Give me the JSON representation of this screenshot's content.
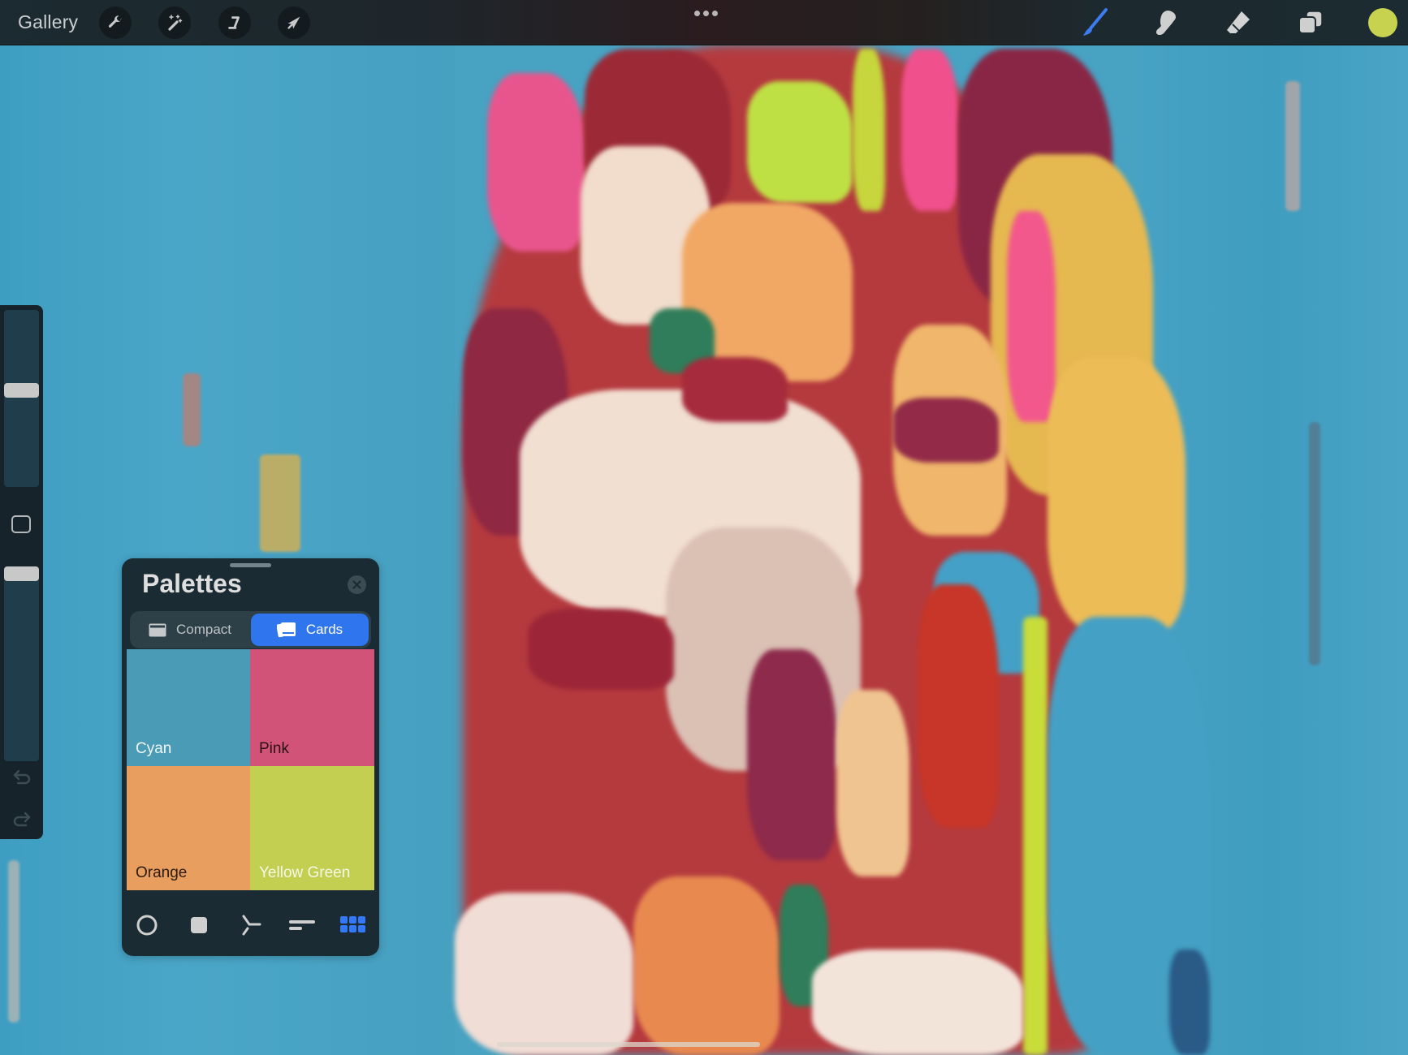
{
  "app": {
    "gallery_label": "Gallery",
    "more_menu_icon": "more-horizontal-icon"
  },
  "toolbar_left": [
    {
      "name": "actions",
      "icon": "wrench-icon"
    },
    {
      "name": "adjustments",
      "icon": "magic-wand-icon"
    },
    {
      "name": "selection",
      "icon": "selection-s-icon"
    },
    {
      "name": "transform",
      "icon": "arrow-cursor-icon"
    }
  ],
  "toolbar_right": [
    {
      "name": "brush",
      "icon": "brush-icon",
      "active": true
    },
    {
      "name": "smudge",
      "icon": "smudge-finger-icon",
      "active": false
    },
    {
      "name": "eraser",
      "icon": "eraser-icon",
      "active": false
    },
    {
      "name": "layers",
      "icon": "layers-icon",
      "active": false
    }
  ],
  "current_color": "#c7d24e",
  "accent_color": "#2f76ee",
  "sidebar": {
    "brush_size_fraction_from_top": 0.45,
    "opacity_fraction": 1.0,
    "modify_button_icon": "square-outline-icon",
    "undo_icon": "undo-icon",
    "redo_icon": "redo-icon"
  },
  "palettes": {
    "title": "Palettes",
    "close_icon": "close-icon",
    "views": [
      {
        "label": "Compact",
        "icon": "compact-card-icon",
        "selected": false
      },
      {
        "label": "Cards",
        "icon": "cards-stack-icon",
        "selected": true
      }
    ],
    "swatches": [
      {
        "name": "Cyan",
        "color": "#4a9bb6",
        "label_color": "#f2f6f8"
      },
      {
        "name": "Pink",
        "color": "#d15478",
        "label_color": "#2a1016"
      },
      {
        "name": "Orange",
        "color": "#e89e5f",
        "label_color": "#2b1a10"
      },
      {
        "name": "Yellow Green",
        "color": "#c2cf50",
        "label_color": "#f5f7e8"
      }
    ],
    "modes": [
      {
        "name": "disc",
        "icon": "circle-disc-icon",
        "active": false
      },
      {
        "name": "classic",
        "icon": "square-classic-icon",
        "active": false
      },
      {
        "name": "harmony",
        "icon": "harmony-icon",
        "active": false
      },
      {
        "name": "value",
        "icon": "value-sliders-icon",
        "active": false
      },
      {
        "name": "palettes",
        "icon": "palettes-grid-icon",
        "active": true
      }
    ]
  }
}
